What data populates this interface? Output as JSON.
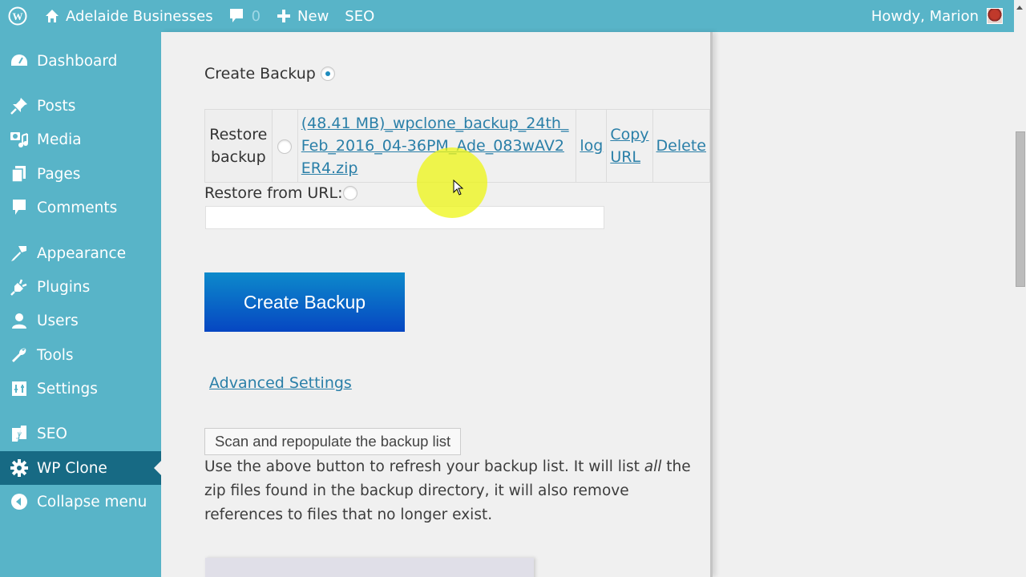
{
  "adminbar": {
    "site_name": "Adelaide Businesses",
    "comment_count": "0",
    "new_label": "New",
    "seo_label": "SEO",
    "greeting": "Howdy, Marion",
    "colors": {
      "bar": "#58b4c8",
      "text": "#ffffff"
    }
  },
  "sidebar": {
    "items": [
      {
        "label": "Dashboard",
        "icon": "dashboard-icon"
      },
      {
        "label": "Posts",
        "icon": "pushpin-icon"
      },
      {
        "label": "Media",
        "icon": "media-icon"
      },
      {
        "label": "Pages",
        "icon": "pages-icon"
      },
      {
        "label": "Comments",
        "icon": "comment-icon"
      },
      {
        "label": "Appearance",
        "icon": "paintbrush-icon"
      },
      {
        "label": "Plugins",
        "icon": "plug-icon"
      },
      {
        "label": "Users",
        "icon": "user-icon"
      },
      {
        "label": "Tools",
        "icon": "wrench-icon"
      },
      {
        "label": "Settings",
        "icon": "settings-icon"
      },
      {
        "label": "SEO",
        "icon": "yoast-icon"
      },
      {
        "label": "WP Clone",
        "icon": "gear-icon",
        "active": true
      },
      {
        "label": "Collapse menu",
        "icon": "collapse-icon"
      }
    ],
    "colors": {
      "background": "#58b4c8",
      "active": "#176a84"
    }
  },
  "main": {
    "create_backup_label": "Create Backup",
    "create_backup_selected": true,
    "restore_backup_label": "Restore backup",
    "backup": {
      "size": "(48.41 MB)",
      "filename": "wpclone_backup_24th_Feb_2016_04-36PM_Ade_083wAV2ER4.zip",
      "link_text": "(48.41 MB)_wpclone_backup_24th_Feb_2016_04-36PM_Ade_083wAV2ER4.zip",
      "log_label": "log",
      "copy_url_label": "Copy URL",
      "delete_label": "Delete"
    },
    "restore_url_label": "Restore from URL:",
    "restore_url_value": "",
    "create_button_label": "Create Backup",
    "advanced_settings_label": "Advanced Settings",
    "scan_button_label": "Scan and repopulate the backup list",
    "description_before": "Use the above button to refresh your backup list. It will list ",
    "description_em": "all",
    "description_after": " the zip files found in the backup directory, it will also remove references to files that no longer exist.",
    "colors": {
      "primary_button_top": "#0d8acb",
      "primary_button_bottom": "#0646c2",
      "link": "#2a7fa8"
    }
  }
}
